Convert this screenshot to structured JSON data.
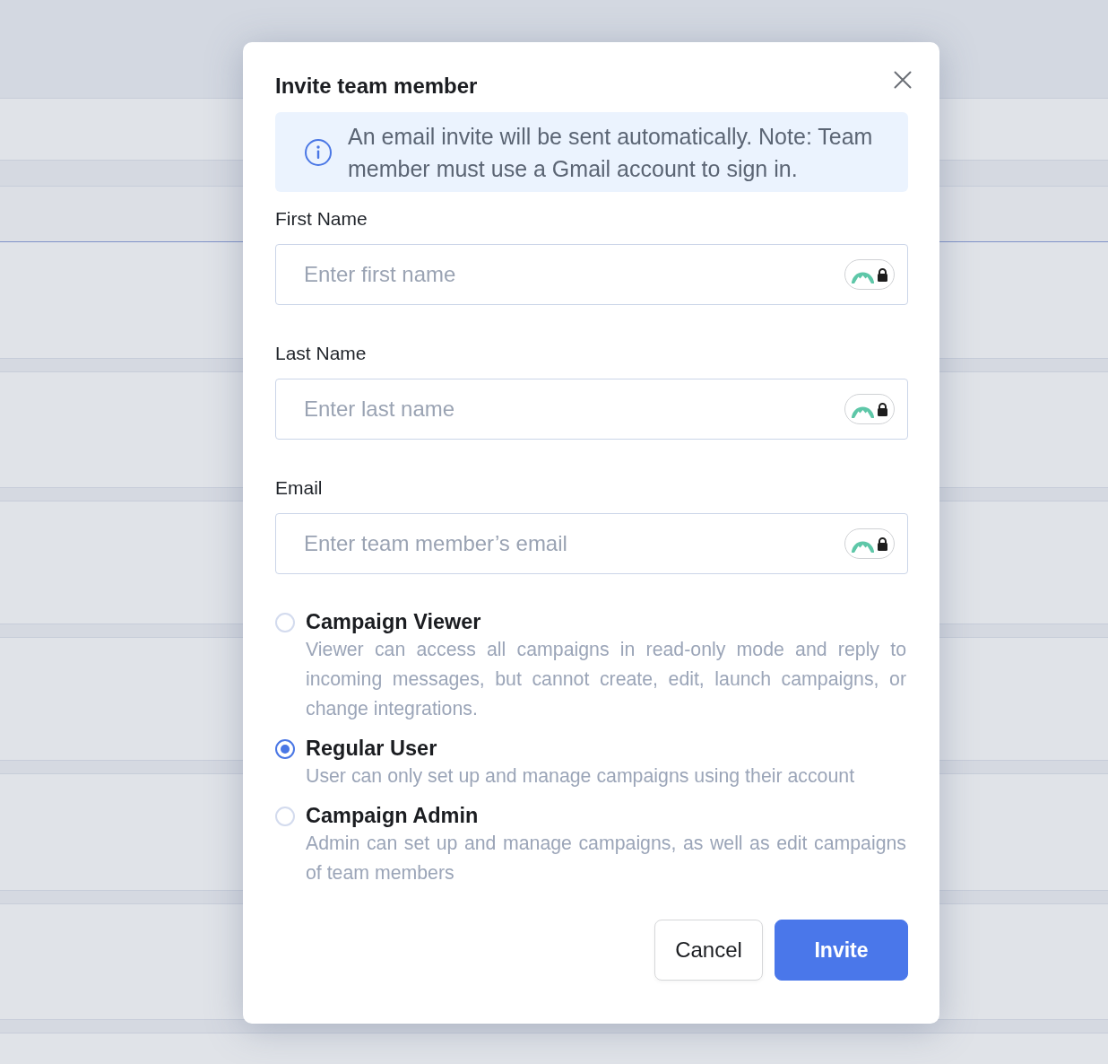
{
  "dialog": {
    "title": "Invite team member"
  },
  "notice": {
    "text": "An email invite will be sent automatically. Note: Team member must use a Gmail account to sign in."
  },
  "fields": [
    {
      "label": "First Name",
      "placeholder": "Enter first name"
    },
    {
      "label": "Last Name",
      "placeholder": "Enter last name"
    },
    {
      "label": "Email",
      "placeholder": "Enter team member’s email"
    }
  ],
  "roles": [
    {
      "name": "Campaign Viewer",
      "description": "Viewer can access all campaigns in read-only mode and reply to incoming messages, but cannot create, edit, launch campaigns, or change integrations.",
      "selected": false
    },
    {
      "name": "Regular User",
      "description": "User can only set up and manage campaigns using their account",
      "selected": true
    },
    {
      "name": "Campaign Admin",
      "description": "Admin can set up and manage campaigns, as well as edit campaigns of team members",
      "selected": false
    }
  ],
  "buttons": [
    {
      "label": "Cancel",
      "kind": "secondary"
    },
    {
      "label": "Invite",
      "kind": "primary"
    }
  ]
}
